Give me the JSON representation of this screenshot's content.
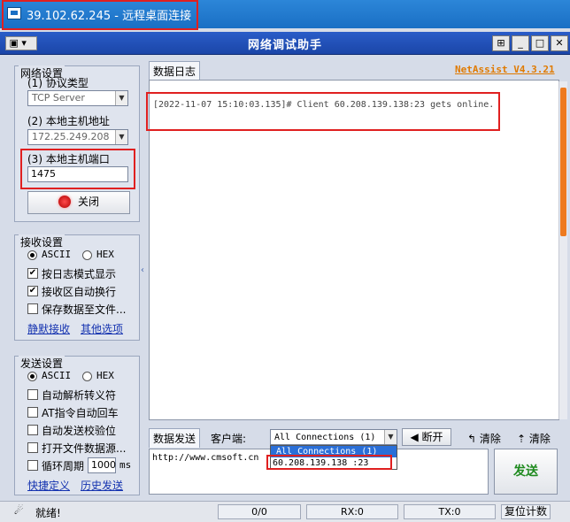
{
  "window_title": "39.102.62.245 - 远程桌面连接",
  "app_title": "网络调试助手",
  "version": "NetAssist V4.3.21",
  "network_settings": {
    "title": "网络设置",
    "protocol_label": "(1) 协议类型",
    "protocol_value": "TCP Server",
    "host_label": "(2) 本地主机地址",
    "host_value": "172.25.249.208",
    "port_label": "(3) 本地主机端口",
    "port_value": "1475",
    "close_button": "关闭"
  },
  "receive_settings": {
    "title": "接收设置",
    "ascii": "ASCII",
    "hex": "HEX",
    "log_mode": "按日志模式显示",
    "auto_wrap": "接收区自动换行",
    "save_to_file": "保存数据至文件...",
    "silent_receive": "静默接收",
    "other_options": "其他选项"
  },
  "send_settings": {
    "title": "发送设置",
    "ascii": "ASCII",
    "hex": "HEX",
    "parse_escape": "自动解析转义符",
    "at_auto_return": "AT指令自动回车",
    "auto_checksum": "自动发送校验位",
    "open_file_source": "打开文件数据源...",
    "loop_period": "循环周期",
    "loop_value": "1000",
    "loop_unit": "ms",
    "quick_define": "快捷定义",
    "history_send": "历史发送"
  },
  "log_tab": "数据日志",
  "log_lines": [
    "[2022-11-07 15:10:03.135]# Client 60.208.139.138:23 gets online."
  ],
  "send_tab": "数据发送",
  "client_label": "客户端:",
  "client_select": "All Connections (1)",
  "client_options": [
    "All Connections (1)",
    "60.208.139.138 :23"
  ],
  "disconnect_button": "断开",
  "clear_button_1": "清除",
  "clear_button_2": "清除",
  "send_text": "http://www.cmsoft.cn",
  "send_button": "发送",
  "status": {
    "ready": "就绪!",
    "counter": "0/0",
    "rx": "RX:0",
    "tx": "TX:0",
    "reset": "复位计数"
  }
}
